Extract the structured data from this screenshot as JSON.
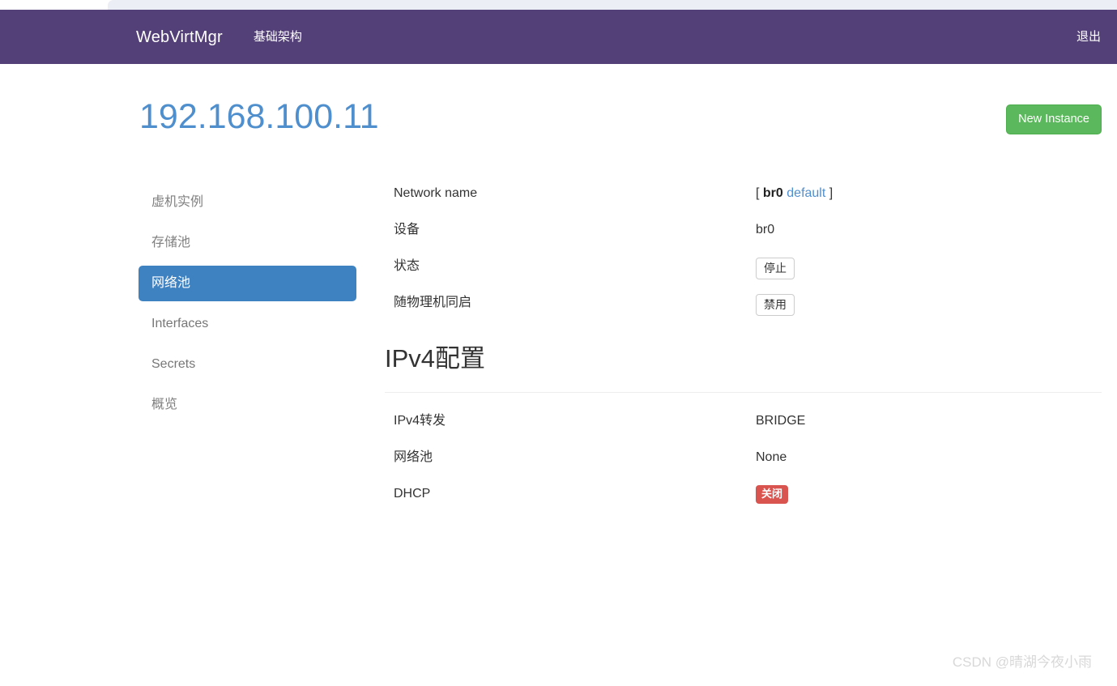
{
  "navbar": {
    "brand": "WebVirtMgr",
    "links": [
      {
        "label": "基础架构",
        "name": "nav-link-infrastructure"
      }
    ],
    "right_links": [
      {
        "label": "退出",
        "name": "nav-link-logout"
      }
    ],
    "background_color": "#544078"
  },
  "header": {
    "title": "192.168.100.11",
    "title_color": "#4f8fce",
    "new_instance_label": "New Instance",
    "new_instance_color": "#5cb85c"
  },
  "sidebar": {
    "items": [
      {
        "label": "虚机实例",
        "active": false,
        "latin": false
      },
      {
        "label": "存储池",
        "active": false,
        "latin": false
      },
      {
        "label": "网络池",
        "active": true,
        "latin": false
      },
      {
        "label": "Interfaces",
        "active": false,
        "latin": true
      },
      {
        "label": "Secrets",
        "active": false,
        "latin": true
      },
      {
        "label": "概览",
        "active": false,
        "latin": false
      }
    ],
    "active_color": "#3f82c2"
  },
  "network_details": {
    "rows": [
      {
        "label": "Network name",
        "value_prefix": "[",
        "value_strong": "br0",
        "value_link": "default",
        "value_suffix": "]",
        "kind": "name"
      },
      {
        "label": "设备",
        "value": "br0",
        "kind": "text"
      },
      {
        "label": "状态",
        "value": "停止",
        "kind": "button"
      },
      {
        "label": "随物理机同启",
        "value": "禁用",
        "kind": "button"
      }
    ]
  },
  "ipv4_section": {
    "title": "IPv4配置",
    "rows": [
      {
        "label": "IPv4转发",
        "value": "BRIDGE",
        "kind": "text"
      },
      {
        "label": "网络池",
        "value": "None",
        "kind": "text"
      },
      {
        "label": "DHCP",
        "value": "关闭",
        "kind": "badge"
      }
    ],
    "badge_color": "#d9534f"
  },
  "watermark": {
    "text": "CSDN @晴湖今夜小雨"
  }
}
